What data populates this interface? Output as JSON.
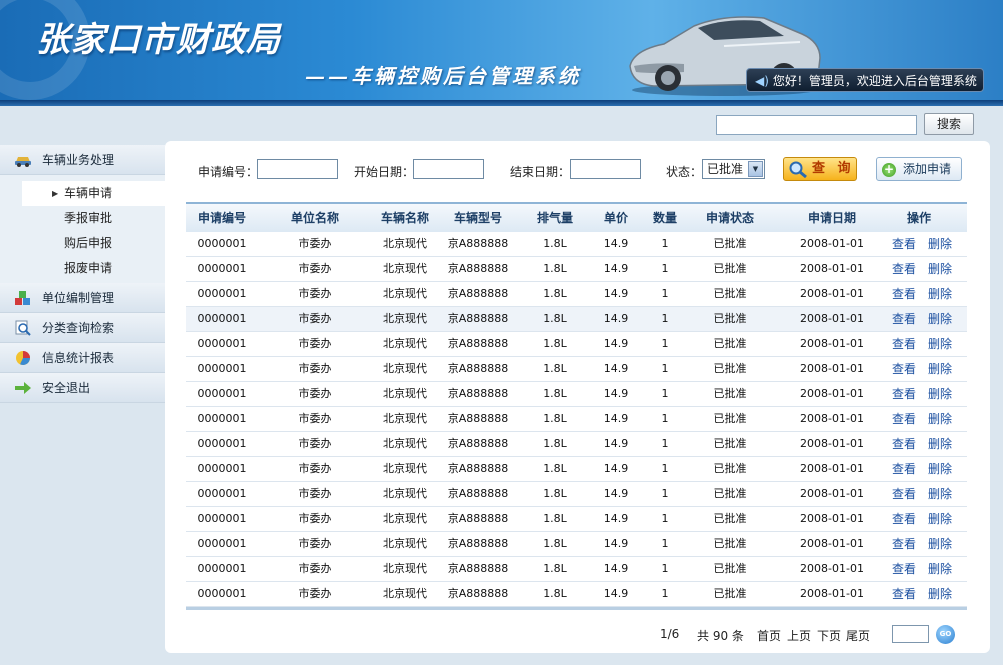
{
  "header": {
    "title": "张家口市财政局",
    "subtitle": "——车辆控购后台管理系统",
    "welcome": "您好！管理员，欢迎进入后台管理系统"
  },
  "top_search": {
    "button": "搜索"
  },
  "sidebar": {
    "groups": [
      {
        "label": "车辆业务处理",
        "icon": "car-service-icon"
      },
      {
        "label": "单位编制管理",
        "icon": "cubes-icon"
      },
      {
        "label": "分类查询检索",
        "icon": "magnifier-icon"
      },
      {
        "label": "信息统计报表",
        "icon": "pie-chart-icon"
      },
      {
        "label": "安全退出",
        "icon": "exit-arrow-icon"
      }
    ],
    "sub_items": [
      "车辆申请",
      "季报审批",
      "购后申报",
      "报废申请"
    ],
    "active_sub": "车辆申请"
  },
  "filter": {
    "app_no_label": "申请编号：",
    "start_label": "开始日期：",
    "end_label": "结束日期：",
    "status_label": "状态：",
    "status_value": "已批准",
    "query_button": "查 询",
    "add_button": "添加申请"
  },
  "table": {
    "headers": [
      "申请编号",
      "单位名称",
      "车辆名称",
      "车辆型号",
      "排气量",
      "单价",
      "数量",
      "申请状态",
      "申请日期",
      "操作"
    ],
    "rows": [
      [
        "0000001",
        "市委办",
        "北京现代",
        "京A888888",
        "1.8L",
        "14.9",
        "1",
        "已批准",
        "2008-01-01"
      ],
      [
        "0000001",
        "市委办",
        "北京现代",
        "京A888888",
        "1.8L",
        "14.9",
        "1",
        "已批准",
        "2008-01-01"
      ],
      [
        "0000001",
        "市委办",
        "北京现代",
        "京A888888",
        "1.8L",
        "14.9",
        "1",
        "已批准",
        "2008-01-01"
      ],
      [
        "0000001",
        "市委办",
        "北京现代",
        "京A888888",
        "1.8L",
        "14.9",
        "1",
        "已批准",
        "2008-01-01"
      ],
      [
        "0000001",
        "市委办",
        "北京现代",
        "京A888888",
        "1.8L",
        "14.9",
        "1",
        "已批准",
        "2008-01-01"
      ],
      [
        "0000001",
        "市委办",
        "北京现代",
        "京A888888",
        "1.8L",
        "14.9",
        "1",
        "已批准",
        "2008-01-01"
      ],
      [
        "0000001",
        "市委办",
        "北京现代",
        "京A888888",
        "1.8L",
        "14.9",
        "1",
        "已批准",
        "2008-01-01"
      ],
      [
        "0000001",
        "市委办",
        "北京现代",
        "京A888888",
        "1.8L",
        "14.9",
        "1",
        "已批准",
        "2008-01-01"
      ],
      [
        "0000001",
        "市委办",
        "北京现代",
        "京A888888",
        "1.8L",
        "14.9",
        "1",
        "已批准",
        "2008-01-01"
      ],
      [
        "0000001",
        "市委办",
        "北京现代",
        "京A888888",
        "1.8L",
        "14.9",
        "1",
        "已批准",
        "2008-01-01"
      ],
      [
        "0000001",
        "市委办",
        "北京现代",
        "京A888888",
        "1.8L",
        "14.9",
        "1",
        "已批准",
        "2008-01-01"
      ],
      [
        "0000001",
        "市委办",
        "北京现代",
        "京A888888",
        "1.8L",
        "14.9",
        "1",
        "已批准",
        "2008-01-01"
      ],
      [
        "0000001",
        "市委办",
        "北京现代",
        "京A888888",
        "1.8L",
        "14.9",
        "1",
        "已批准",
        "2008-01-01"
      ],
      [
        "0000001",
        "市委办",
        "北京现代",
        "京A888888",
        "1.8L",
        "14.9",
        "1",
        "已批准",
        "2008-01-01"
      ],
      [
        "0000001",
        "市委办",
        "北京现代",
        "京A888888",
        "1.8L",
        "14.9",
        "1",
        "已批准",
        "2008-01-01"
      ]
    ],
    "actions": [
      "查看",
      "删除"
    ]
  },
  "pager": {
    "page": "1/6",
    "total": "共 90 条",
    "first": "首页",
    "prev": "上页",
    "next": "下页",
    "last": "尾页",
    "go": "GO"
  }
}
